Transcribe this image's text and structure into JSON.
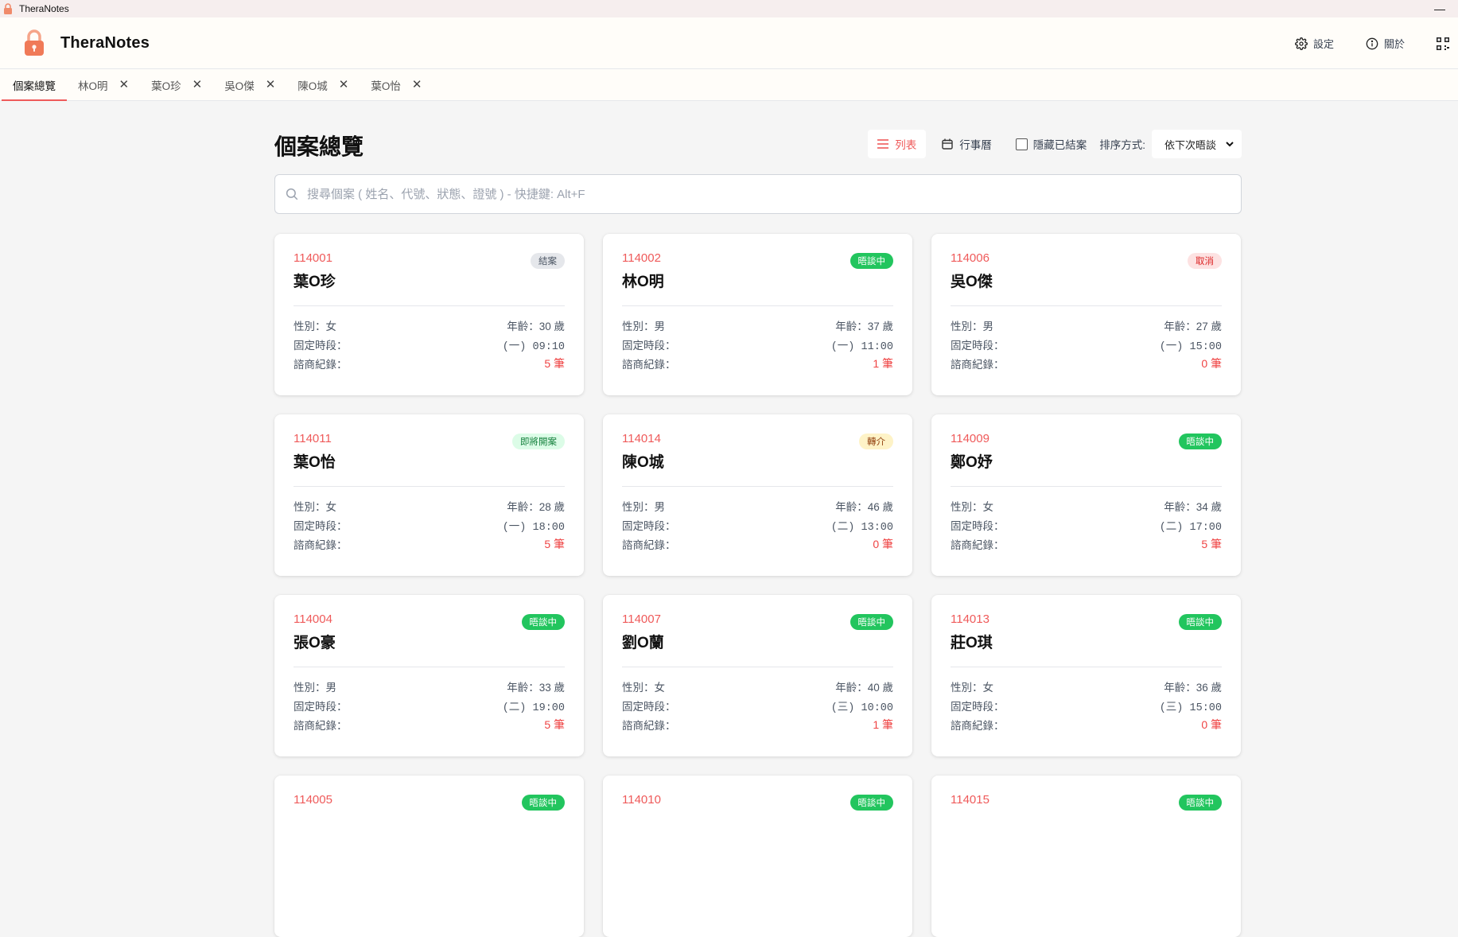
{
  "window": {
    "title": "TheraNotes",
    "minimize_glyph": "—"
  },
  "header": {
    "brand_name": "TheraNotes",
    "settings_label": "設定",
    "about_label": "關於"
  },
  "tabs": [
    {
      "label": "個案總覽",
      "closable": false
    },
    {
      "label": "林O明",
      "closable": true
    },
    {
      "label": "葉O珍",
      "closable": true
    },
    {
      "label": "吳O傑",
      "closable": true
    },
    {
      "label": "陳O城",
      "closable": true
    },
    {
      "label": "葉O怡",
      "closable": true
    }
  ],
  "page": {
    "title": "個案總覽",
    "view_list_label": "列表",
    "view_calendar_label": "行事曆",
    "hide_closed_label": "隱藏已結案",
    "sort_label": "排序方式:",
    "sort_value": "依下次晤談",
    "search_placeholder": "搜尋個案 ( 姓名、代號、狀態、證號 ) - 快捷鍵: Alt+F",
    "search_value": ""
  },
  "field_labels": {
    "gender": "性別：",
    "schedule": "固定時段：",
    "records": "諮商紀錄："
  },
  "colors": {
    "accent": "#ef5a5a",
    "badge_active_bg": "#22c55e",
    "badge_closed_bg": "#e5e7eb",
    "badge_cancel_bg": "#fde2e2",
    "badge_upcoming_bg": "#dcfce7",
    "badge_referral_bg": "#fef3c7"
  },
  "cases": [
    {
      "code": "114001",
      "name": "葉O珍",
      "status": "結案",
      "status_type": "closed",
      "gender": "女",
      "age": "年齡：30 歲",
      "schedule": "(一) 09:10",
      "records": "5 筆"
    },
    {
      "code": "114002",
      "name": "林O明",
      "status": "晤談中",
      "status_type": "active",
      "gender": "男",
      "age": "年齡：37 歲",
      "schedule": "(一) 11:00",
      "records": "1 筆"
    },
    {
      "code": "114006",
      "name": "吳O傑",
      "status": "取消",
      "status_type": "cancel",
      "gender": "男",
      "age": "年齡：27 歲",
      "schedule": "(一) 15:00",
      "records": "0 筆"
    },
    {
      "code": "114011",
      "name": "葉O怡",
      "status": "即將開案",
      "status_type": "upcoming",
      "gender": "女",
      "age": "年齡：28 歲",
      "schedule": "(一) 18:00",
      "records": "5 筆"
    },
    {
      "code": "114014",
      "name": "陳O城",
      "status": "轉介",
      "status_type": "referral",
      "gender": "男",
      "age": "年齡：46 歲",
      "schedule": "(二) 13:00",
      "records": "0 筆"
    },
    {
      "code": "114009",
      "name": "鄭O妤",
      "status": "晤談中",
      "status_type": "active",
      "gender": "女",
      "age": "年齡：34 歲",
      "schedule": "(二) 17:00",
      "records": "5 筆"
    },
    {
      "code": "114004",
      "name": "張O豪",
      "status": "晤談中",
      "status_type": "active",
      "gender": "男",
      "age": "年齡：33 歲",
      "schedule": "(二) 19:00",
      "records": "5 筆"
    },
    {
      "code": "114007",
      "name": "劉O蘭",
      "status": "晤談中",
      "status_type": "active",
      "gender": "女",
      "age": "年齡：40 歲",
      "schedule": "(三) 10:00",
      "records": "1 筆"
    },
    {
      "code": "114013",
      "name": "莊O琪",
      "status": "晤談中",
      "status_type": "active",
      "gender": "女",
      "age": "年齡：36 歲",
      "schedule": "(三) 15:00",
      "records": "0 筆"
    },
    {
      "code": "114005",
      "name": "",
      "status": "晤談中",
      "status_type": "active",
      "gender": "",
      "age": "",
      "schedule": "",
      "records": ""
    },
    {
      "code": "114010",
      "name": "",
      "status": "晤談中",
      "status_type": "active",
      "gender": "",
      "age": "",
      "schedule": "",
      "records": ""
    },
    {
      "code": "114015",
      "name": "",
      "status": "晤談中",
      "status_type": "active",
      "gender": "",
      "age": "",
      "schedule": "",
      "records": ""
    }
  ]
}
